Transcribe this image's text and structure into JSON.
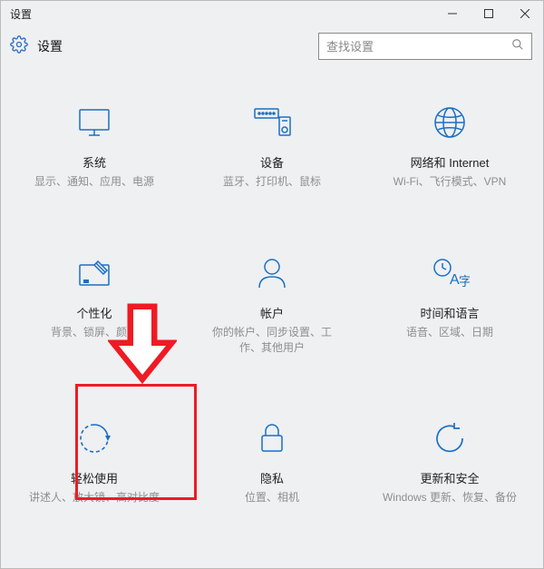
{
  "window": {
    "title": "设置"
  },
  "header": {
    "title": "设置"
  },
  "search": {
    "placeholder": "查找设置"
  },
  "tiles": [
    {
      "title": "系统",
      "desc": "显示、通知、应用、电源"
    },
    {
      "title": "设备",
      "desc": "蓝牙、打印机、鼠标"
    },
    {
      "title": "网络和 Internet",
      "desc": "Wi-Fi、飞行模式、VPN"
    },
    {
      "title": "个性化",
      "desc": "背景、锁屏、颜色"
    },
    {
      "title": "帐户",
      "desc": "你的帐户、同步设置、工作、其他用户"
    },
    {
      "title": "时间和语言",
      "desc": "语音、区域、日期"
    },
    {
      "title": "轻松使用",
      "desc": "讲述人、放大镜、高对比度"
    },
    {
      "title": "隐私",
      "desc": "位置、相机"
    },
    {
      "title": "更新和安全",
      "desc": "Windows 更新、恢复、备份"
    }
  ],
  "annotation": {
    "color": "#ee1b24"
  }
}
